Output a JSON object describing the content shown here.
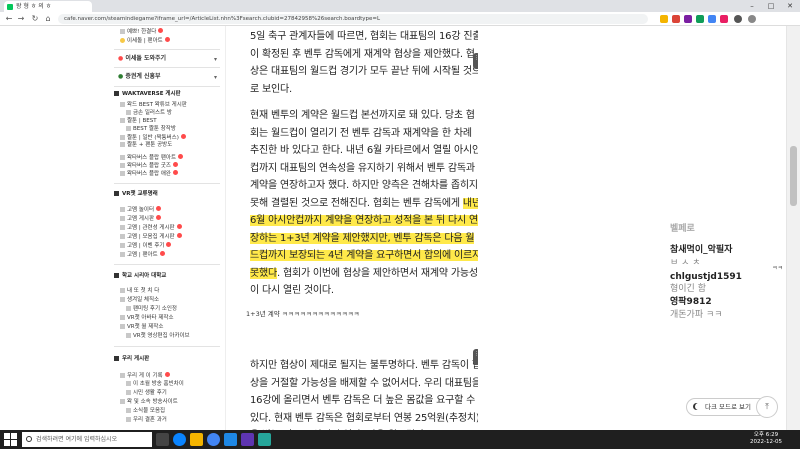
{
  "browser": {
    "tab_title": "왕 형 ㅎ 의 ㅎ",
    "url": "cafe.naver.com/steamindiegame?iframe_url=/ArticleList.nhn%3Fsearch.clubid=27842958%26search.boardtype=L",
    "nav": {
      "back": "←",
      "forward": "→",
      "reload": "↻",
      "home": "⌂"
    },
    "window": {
      "minimize": "–",
      "maximize": "□",
      "close": "✕"
    }
  },
  "sidebar": {
    "top_items": [
      {
        "label": "예쁘! 한결다"
      },
      {
        "label": "이세돌 | 팬아트"
      }
    ],
    "folds": [
      {
        "label": "이세돌 도와주기"
      },
      {
        "label": "증권계 신흥부"
      }
    ],
    "sections": [
      {
        "title": "WAKTAVERSE 게시판",
        "items": [
          "왁드 BEST 왁튜브 게시판",
          "금손 일러스트 방",
          "짤툰 | BEST",
          "BEST 짤툰 창작방",
          "짤툰 | 일반 (짝퉁버스)",
          "짤툰 + 팬툰 공방도",
          "왁타버스 플랍 팬아트",
          "왁타버스 플랍 굿즈",
          "왁타버스 플랍 애완"
        ]
      },
      {
        "title": "VR챗 교류명래",
        "items": [
          "고멤 놀이터",
          "고멤 게시판",
          "고멤 | 관련성 게시판",
          "고멤 | 모음집 게시판",
          "고멤 | 이벤 후기",
          "고멤 | 팬아트"
        ]
      },
      {
        "title": "학교 시리아 대학교",
        "items": [
          "내 또 첫 치 다",
          "생겨일 체직소",
          "팬미팅 후기 소인정",
          "VR챗 아바타 제작소",
          "VR챗 월 제작소",
          "VR챗 영상편집 아카이브"
        ]
      },
      {
        "title": "우리 게시판",
        "items": [
          "우리 게 이 기록",
          "이 초월 방송 홈빈차이",
          "시민 생활 후기",
          "왁 및 소속 방송사이트",
          "소식물 모음집",
          "우리 결혼 과거"
        ]
      }
    ]
  },
  "article": {
    "paragraphs": [
      [
        {
          "t": "5일 축구 관계자들에 따르면, 협회는 대표팀의 16강 진출이 확정된 후 벤투 감독에게 재계약 협상을 제안했다. 협상은 대표팀의 월드컵 경기가 모두 끝난 뒤에 시작될 것으로 보인다."
        }
      ],
      [
        {
          "t": "현재 벤투의 계약은 월드컵 본선까지로 돼 있다. 당초 협회는 월드컵이 열리기 전 벤투 감독과 재계약을 한 차례 추진한 바 있다고 한다. 내년 6월 카타르에서 열릴 아시안컵까지 대표팀의 연속성을 유지하기 위해서 벤투 감독과 계약을 연장하고자 했다. 하지만 양측은 견해차를 좁히지 못해 결렬된 것으로 전해진다. 협회는 벤투 감독에게 "
        },
        {
          "t": "내년 6월 아시안컵까지 계약을 연장하고 성적을 본 뒤 다시 연장하는 1+3년 계약을 제안했지만, 벤투 감독은 다음 월드컵까지 보장되는 4년 계약을 요구하면서 합의에 이르지 못했다",
          "hl": true
        },
        {
          "t": ". 협회가 이번에 협상을 제안하면서 재계약 가능성이 다시 열린 것이다."
        }
      ],
      [
        {
          "t": "하지만 협상이 제대로 될지는 불투명하다. 벤투 감독이 협상을 거절할 가능성을 배제할 수 없어서다. 우리 대표팀을 16강에 올리면서 벤투 감독은 더 높은 몸값을 요구할 수 있다. 현재 벤투 감독은 협회로부터 연봉 25억원(추정치)을 받는 것으로 알려져 있다. 다음 월드컵까"
        }
      ]
    ],
    "caption": "1+3년 계약 ㅋㅋㅋㅋㅋㅋㅋㅋㅋㅋㅋㅋㅋ",
    "handle_glyph": "⋮"
  },
  "chat": {
    "lines": [
      {
        "kind": "nick",
        "text": "벨페로"
      },
      {
        "kind": "nick",
        "text": "참새먹이_악필자"
      },
      {
        "kind": "msg",
        "text": "ㅂ ㅅ ㅊ"
      },
      {
        "kind": "nick",
        "text": "chlgustjd1591"
      },
      {
        "kind": "msg",
        "text": "형이긴 함"
      },
      {
        "kind": "nick",
        "text": "영팍9812"
      },
      {
        "kind": "msg",
        "text": "개돈가파 ㅋㅋ"
      }
    ],
    "dark_mode_label": "다크 모드로 보기",
    "top_button": "⤒",
    "side_badge": "ㅋㅋ"
  },
  "taskbar": {
    "search_placeholder": "검색하려면 여기에 입력하십시오",
    "time": "오후 6:29",
    "date": "2022-12-05"
  },
  "colors": {
    "highlight": "#ffe94a",
    "taskbar": "#1f1f1f",
    "naver_green": "#03c75a"
  }
}
